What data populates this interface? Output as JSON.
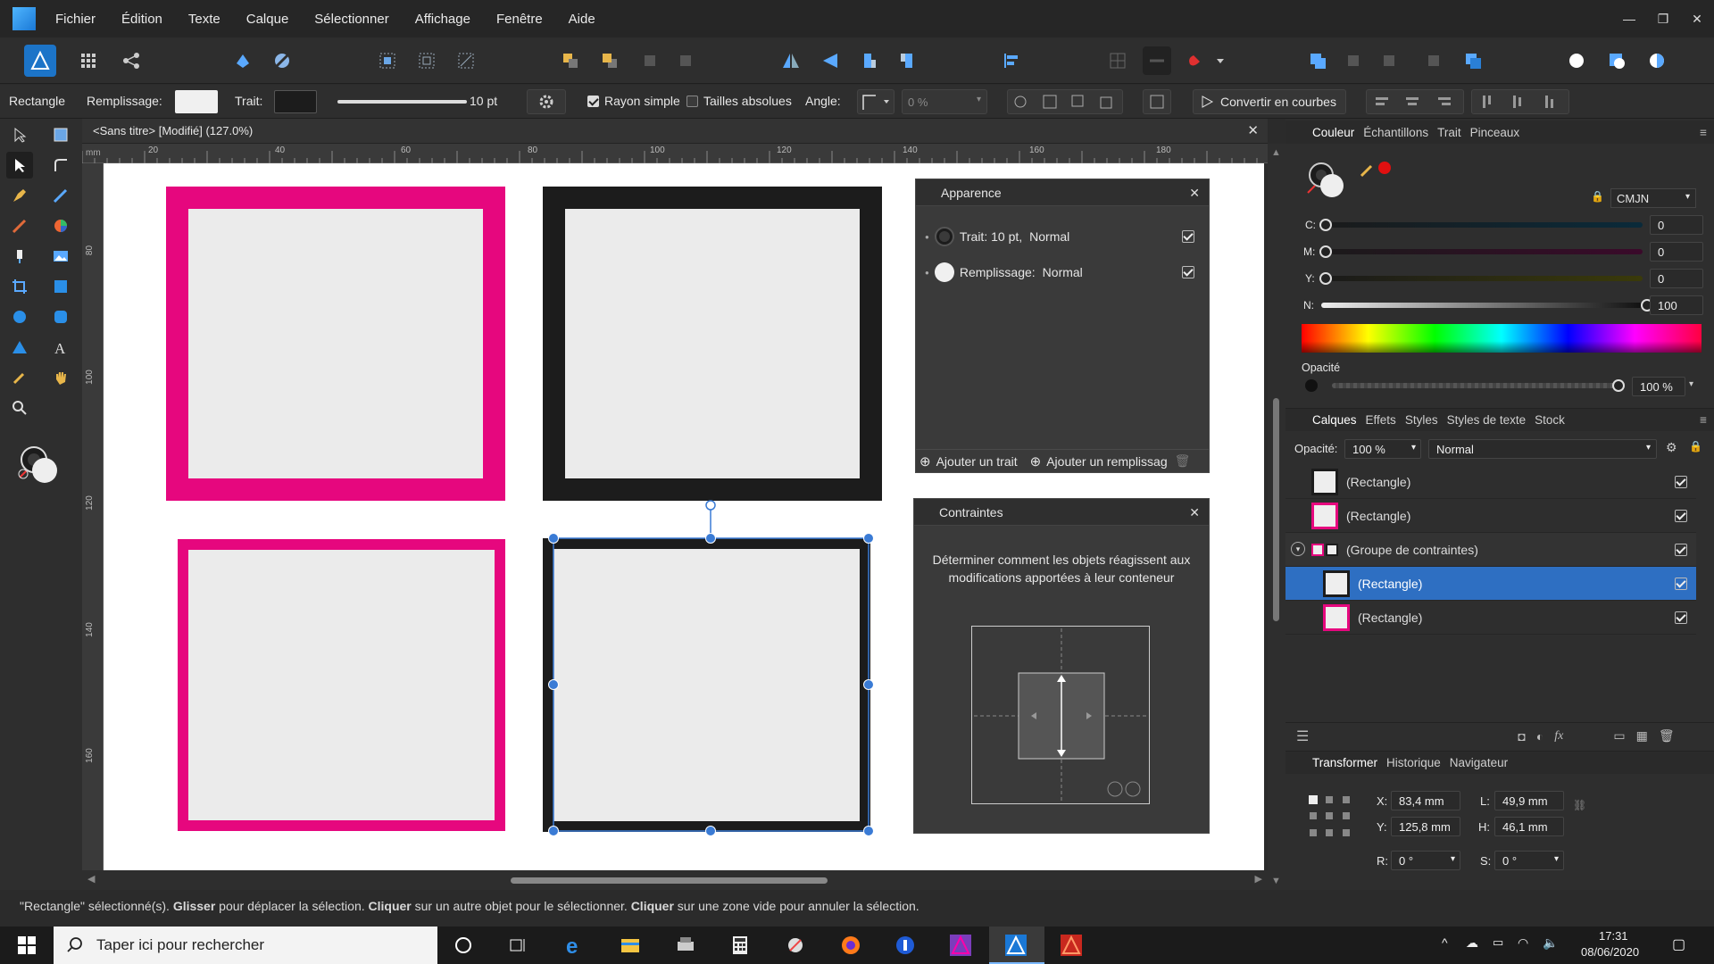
{
  "menu": {
    "items": [
      "Fichier",
      "Édition",
      "Texte",
      "Calque",
      "Sélectionner",
      "Affichage",
      "Fenêtre",
      "Aide"
    ]
  },
  "context": {
    "tool": "Rectangle",
    "fill_label": "Remplissage:",
    "stroke_label": "Trait:",
    "stroke_width": "10 pt",
    "simple_radius": "Rayon simple",
    "absolute_sizes": "Tailles absolues",
    "angle_label": "Angle:",
    "angle_value": "0 %",
    "convert_curves": "Convertir en courbes",
    "fill_color": "#f0f0f0",
    "stroke_color": "#1c1c1c"
  },
  "document": {
    "title": "<Sans titre> [Modifié] (127.0%)",
    "unit": "mm",
    "ruler_h": [
      "20",
      "40",
      "60",
      "80",
      "100",
      "120",
      "140",
      "160",
      "180"
    ],
    "ruler_v": [
      "80",
      "100",
      "120",
      "140",
      "160"
    ]
  },
  "colors": {
    "pink": "#e6077e",
    "black": "#1c1c1c",
    "inner": "#ebebeb",
    "accent": "#2e6fc2",
    "selection": "#3a7bd5"
  },
  "appearance": {
    "title": "Apparence",
    "stroke_row": "Trait: 10 pt,",
    "stroke_mode": "Normal",
    "fill_row": "Remplissage:",
    "fill_mode": "Normal",
    "add_stroke": "Ajouter un trait",
    "add_fill": "Ajouter un remplissag"
  },
  "constraints": {
    "title": "Contraintes",
    "description": "Déterminer comment les objets réagissent aux modifications apportées à leur conteneur"
  },
  "color_panel": {
    "tabs": [
      "Couleur",
      "Échantillons",
      "Trait",
      "Pinceaux"
    ],
    "model": "CMJN",
    "channels": [
      {
        "label": "C:",
        "value": "0",
        "level": 0
      },
      {
        "label": "M:",
        "value": "0",
        "level": 0
      },
      {
        "label": "Y:",
        "value": "0",
        "level": 0
      },
      {
        "label": "N:",
        "value": "100",
        "level": 1
      }
    ],
    "opacity_label": "Opacité",
    "opacity_value": "100 %"
  },
  "layers_panel": {
    "tabs": [
      "Calques",
      "Effets",
      "Styles",
      "Styles de texte",
      "Stock"
    ],
    "opacity_label": "Opacité:",
    "opacity_value": "100 %",
    "blend": "Normal",
    "rows": [
      {
        "name": "(Rectangle)",
        "thumb": "black",
        "selected": false,
        "indent": false
      },
      {
        "name": "(Rectangle)",
        "thumb": "pink",
        "selected": false,
        "indent": false
      },
      {
        "name": "(Groupe de contraintes)",
        "thumb": "group",
        "selected": false,
        "indent": false
      },
      {
        "name": "(Rectangle)",
        "thumb": "black",
        "selected": true,
        "indent": true
      },
      {
        "name": "(Rectangle)",
        "thumb": "pink",
        "selected": false,
        "indent": true
      }
    ]
  },
  "transform_panel": {
    "tabs": [
      "Transformer",
      "Historique",
      "Navigateur"
    ],
    "x_label": "X:",
    "x": "83,4 mm",
    "w_label": "L:",
    "w": "49,9 mm",
    "y_label": "Y:",
    "y": "125,8 mm",
    "h_label": "H:",
    "h": "46,1 mm",
    "r_label": "R:",
    "r": "0 °",
    "s_label": "S:",
    "s": "0 °"
  },
  "status": {
    "p1": "\"Rectangle\" sélectionné(s). ",
    "b1": "Glisser",
    "p2": " pour déplacer la sélection. ",
    "b2": "Cliquer",
    "p3": " sur un autre objet pour le sélectionner. ",
    "b3": "Cliquer",
    "p4": " sur une zone vide pour annuler la sélection."
  },
  "taskbar": {
    "search": "Taper ici pour rechercher",
    "time": "17:31",
    "date": "08/06/2020"
  }
}
